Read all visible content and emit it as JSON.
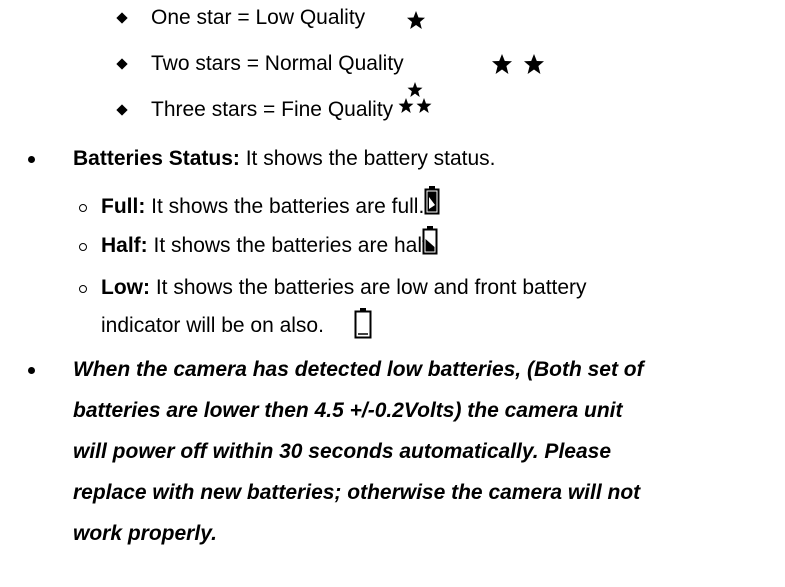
{
  "quality": {
    "items": [
      {
        "label": "One star = Low Quality",
        "icon": "one-star-icon"
      },
      {
        "label": "Two stars = Normal Quality",
        "icon": "two-stars-icon"
      },
      {
        "label": "Three stars = Fine Quality",
        "icon": "three-stars-icon"
      }
    ]
  },
  "battery": {
    "heading": "Batteries Status:",
    "description": " It shows the battery status.",
    "items": [
      {
        "label": "Full:",
        "text": " It shows the batteries are full.",
        "icon": "battery-full-icon"
      },
      {
        "label": "Half:",
        "text": " It shows the batteries are half.",
        "icon": "battery-half-icon"
      },
      {
        "label": "Low:",
        "text": " It shows the batteries are low and front battery",
        "text2": "indicator will be on also.",
        "icon": "battery-empty-icon"
      }
    ]
  },
  "warning": {
    "lines": [
      "When the camera has detected low batteries, (Both set of",
      "batteries are lower then 4.5 +/-0.2Volts) the camera unit",
      "will power off within 30 seconds automatically. Please",
      "replace with new batteries; otherwise the camera will not",
      "work properly."
    ]
  }
}
